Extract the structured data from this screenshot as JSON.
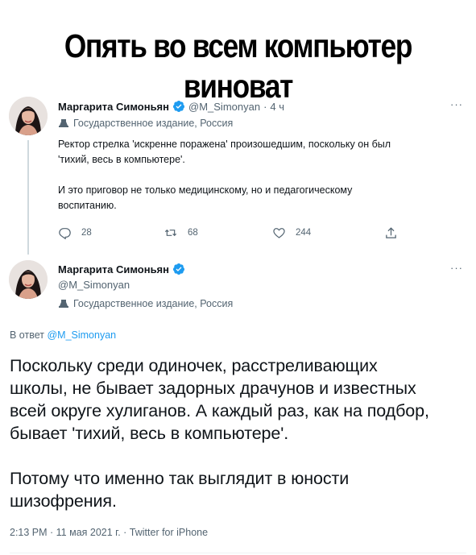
{
  "meme_title": "Опять во всем компьютер виноват",
  "tweet1": {
    "name": "Маргарита Симоньян",
    "handle": "@M_Simonyan",
    "separator": "·",
    "time": "4 ч",
    "state_label": "Государственное издание, Россия",
    "text_p1_l1": "Ректор стрелка 'искренне поражена' произошедшим, поскольку он был",
    "text_p1_l2": "'тихий, весь в компьютере'.",
    "text_p2_l1": "И это приговор не только медицинскому, но и педагогическому",
    "text_p2_l2": "воспитанию.",
    "reply_count": "28",
    "retweet_count": "68",
    "like_count": "244",
    "more": "···"
  },
  "tweet2": {
    "name": "Маргарита Симоньян",
    "handle": "@M_Simonyan",
    "state_label": "Государственное издание, Россия",
    "more": "···",
    "reply_prefix": "В ответ",
    "reply_mention": "@M_Simonyan",
    "text_l1": "Поскольку среди одиночек, расстреливающих",
    "text_l2": "школы, не бывает задорных драчунов и известных",
    "text_l3": "всей округе хулиганов. А каждый раз, как на подбор,",
    "text_l4": "бывает 'тихий, весь в компьютере'.",
    "text_l5": "Потому что именно так выглядит в юности",
    "text_l6": "шизофрения.",
    "meta": "2:13 PM · 11 мая 2021 г. · Twitter for iPhone"
  },
  "colors": {
    "text": "#0f1419",
    "secondary": "#536471",
    "link": "#1d9bf0",
    "verified": "#1d9bf0"
  },
  "icons": [
    "verified-badge-icon",
    "state-media-icon",
    "reply-icon",
    "retweet-icon",
    "like-icon",
    "share-icon",
    "more-icon"
  ]
}
